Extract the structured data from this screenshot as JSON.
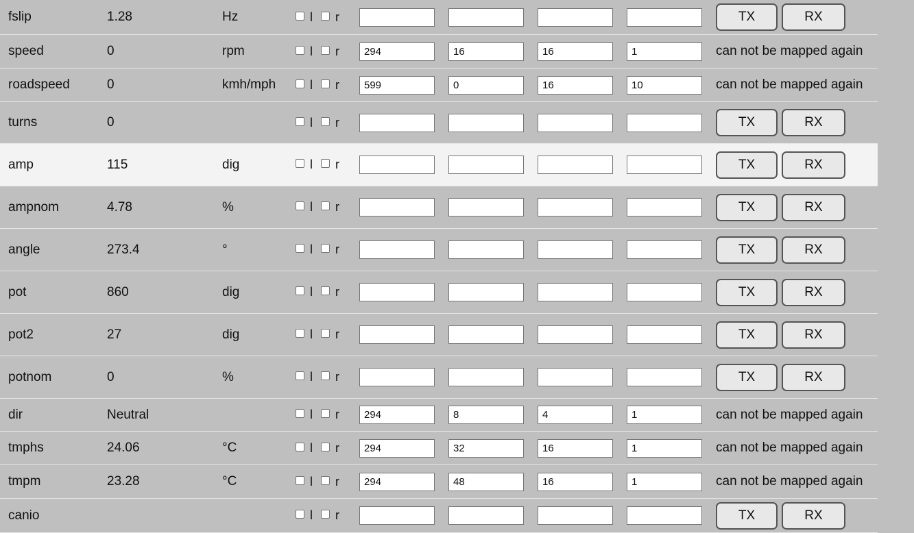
{
  "rows": [
    {
      "name": "fslip",
      "value": "1.28",
      "unit": "Hz",
      "fields": [
        "",
        "",
        "",
        ""
      ],
      "mapped": false
    },
    {
      "name": "speed",
      "value": "0",
      "unit": "rpm",
      "fields": [
        "294",
        "16",
        "16",
        "1"
      ],
      "mapped": true
    },
    {
      "name": "roadspeed",
      "value": "0",
      "unit": "kmh/mph",
      "fields": [
        "599",
        "0",
        "16",
        "10"
      ],
      "mapped": true
    },
    {
      "name": "turns",
      "value": "0",
      "unit": "",
      "fields": [
        "",
        "",
        "",
        ""
      ],
      "mapped": false
    },
    {
      "name": "amp",
      "value": "115",
      "unit": "dig",
      "fields": [
        "",
        "",
        "",
        ""
      ],
      "mapped": false,
      "highlight": true
    },
    {
      "name": "ampnom",
      "value": "4.78",
      "unit": "%",
      "fields": [
        "",
        "",
        "",
        ""
      ],
      "mapped": false
    },
    {
      "name": "angle",
      "value": "273.4",
      "unit": "°",
      "fields": [
        "",
        "",
        "",
        ""
      ],
      "mapped": false
    },
    {
      "name": "pot",
      "value": "860",
      "unit": "dig",
      "fields": [
        "",
        "",
        "",
        ""
      ],
      "mapped": false
    },
    {
      "name": "pot2",
      "value": "27",
      "unit": "dig",
      "fields": [
        "",
        "",
        "",
        ""
      ],
      "mapped": false
    },
    {
      "name": "potnom",
      "value": "0",
      "unit": "%",
      "fields": [
        "",
        "",
        "",
        ""
      ],
      "mapped": false
    },
    {
      "name": "dir",
      "value": "Neutral",
      "unit": "",
      "fields": [
        "294",
        "8",
        "4",
        "1"
      ],
      "mapped": true
    },
    {
      "name": "tmphs",
      "value": "24.06",
      "unit": "°C",
      "fields": [
        "294",
        "32",
        "16",
        "1"
      ],
      "mapped": true
    },
    {
      "name": "tmpm",
      "value": "23.28",
      "unit": "°C",
      "fields": [
        "294",
        "48",
        "16",
        "1"
      ],
      "mapped": true
    },
    {
      "name": "canio",
      "value": "",
      "unit": "",
      "fields": [
        "",
        "",
        "",
        ""
      ],
      "mapped": false
    }
  ],
  "labels": {
    "check_l": "l",
    "check_r": "r",
    "tx": "TX",
    "rx": "RX",
    "mapped_note": "can not be mapped again"
  }
}
